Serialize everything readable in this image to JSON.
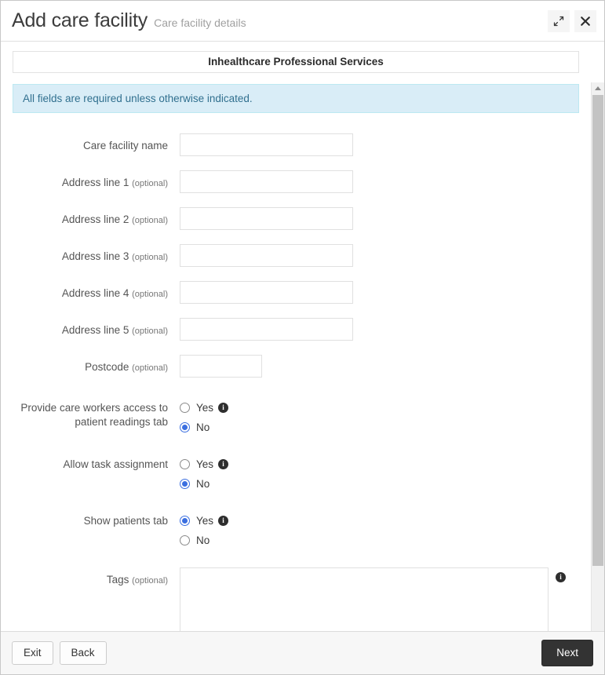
{
  "header": {
    "title": "Add care facility",
    "subtitle": "Care facility details",
    "expand_icon": "expand-diagonal-icon",
    "close_icon": "close-icon"
  },
  "panel": {
    "title": "Inhealthcare Professional Services",
    "alert": "All fields are required unless otherwise indicated."
  },
  "fields": [
    {
      "label": "Care facility name",
      "optional": "",
      "value": "",
      "type": "text"
    },
    {
      "label": "Address line 1",
      "optional": "(optional)",
      "value": "",
      "type": "text"
    },
    {
      "label": "Address line 2",
      "optional": "(optional)",
      "value": "",
      "type": "text"
    },
    {
      "label": "Address line 3",
      "optional": "(optional)",
      "value": "",
      "type": "text"
    },
    {
      "label": "Address line 4",
      "optional": "(optional)",
      "value": "",
      "type": "text"
    },
    {
      "label": "Address line 5",
      "optional": "(optional)",
      "value": "",
      "type": "text"
    },
    {
      "label": "Postcode",
      "optional": "(optional)",
      "value": "",
      "type": "text-narrow"
    }
  ],
  "radio_groups": [
    {
      "label_line1": "Provide care workers access to",
      "label_line2": "patient readings tab",
      "yes_label": "Yes",
      "no_label": "No",
      "selected": "No",
      "info_icon": "info-icon"
    },
    {
      "label_line1": "Allow task assignment",
      "label_line2": "",
      "yes_label": "Yes",
      "no_label": "No",
      "selected": "No",
      "info_icon": "info-icon"
    },
    {
      "label_line1": "Show patients tab",
      "label_line2": "",
      "yes_label": "Yes",
      "no_label": "No",
      "selected": "Yes",
      "info_icon": "info-icon"
    }
  ],
  "tags": {
    "label": "Tags",
    "optional": "(optional)",
    "value": "",
    "info_icon": "info-icon"
  },
  "footer": {
    "exit_label": "Exit",
    "back_label": "Back",
    "next_label": "Next"
  },
  "colors": {
    "alert_bg": "#d9edf7",
    "alert_border": "#bce8f1",
    "alert_text": "#31708f",
    "radio_selected": "#3b6fe0",
    "primary_button_bg": "#333333",
    "info_icon_bg": "#2e2e2e"
  }
}
